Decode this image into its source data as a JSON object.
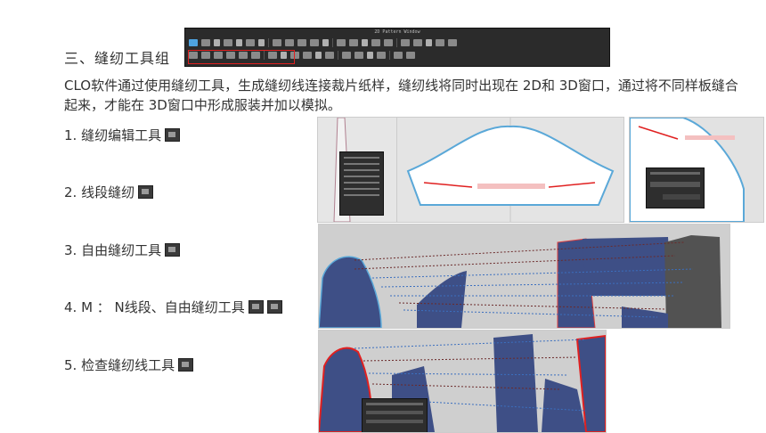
{
  "section": {
    "title": "三、缝纫工具组"
  },
  "toolbar": {
    "title": "2D Pattern Window"
  },
  "intro": "CLO软件通过使用缝纫工具，生成缝纫线连接裁片纸样，缝纫线将同时出现在 2D和 3D窗口，通过将不同样板缝合起来，才能在 3D窗口中形成服装并加以模拟。",
  "items": [
    {
      "label": "1. 缝纫编辑工具"
    },
    {
      "label": "2. 线段缝纫"
    },
    {
      "label": "3. 自由缝纫工具"
    },
    {
      "label": "4. M ： N线段、自由缝纫工具"
    },
    {
      "label": "5. 检查缝纫线工具"
    }
  ],
  "colors": {
    "pattern_blue": "#3e4f86",
    "dark_panel": "#2e2e2e",
    "highlight_red": "#e02020"
  }
}
